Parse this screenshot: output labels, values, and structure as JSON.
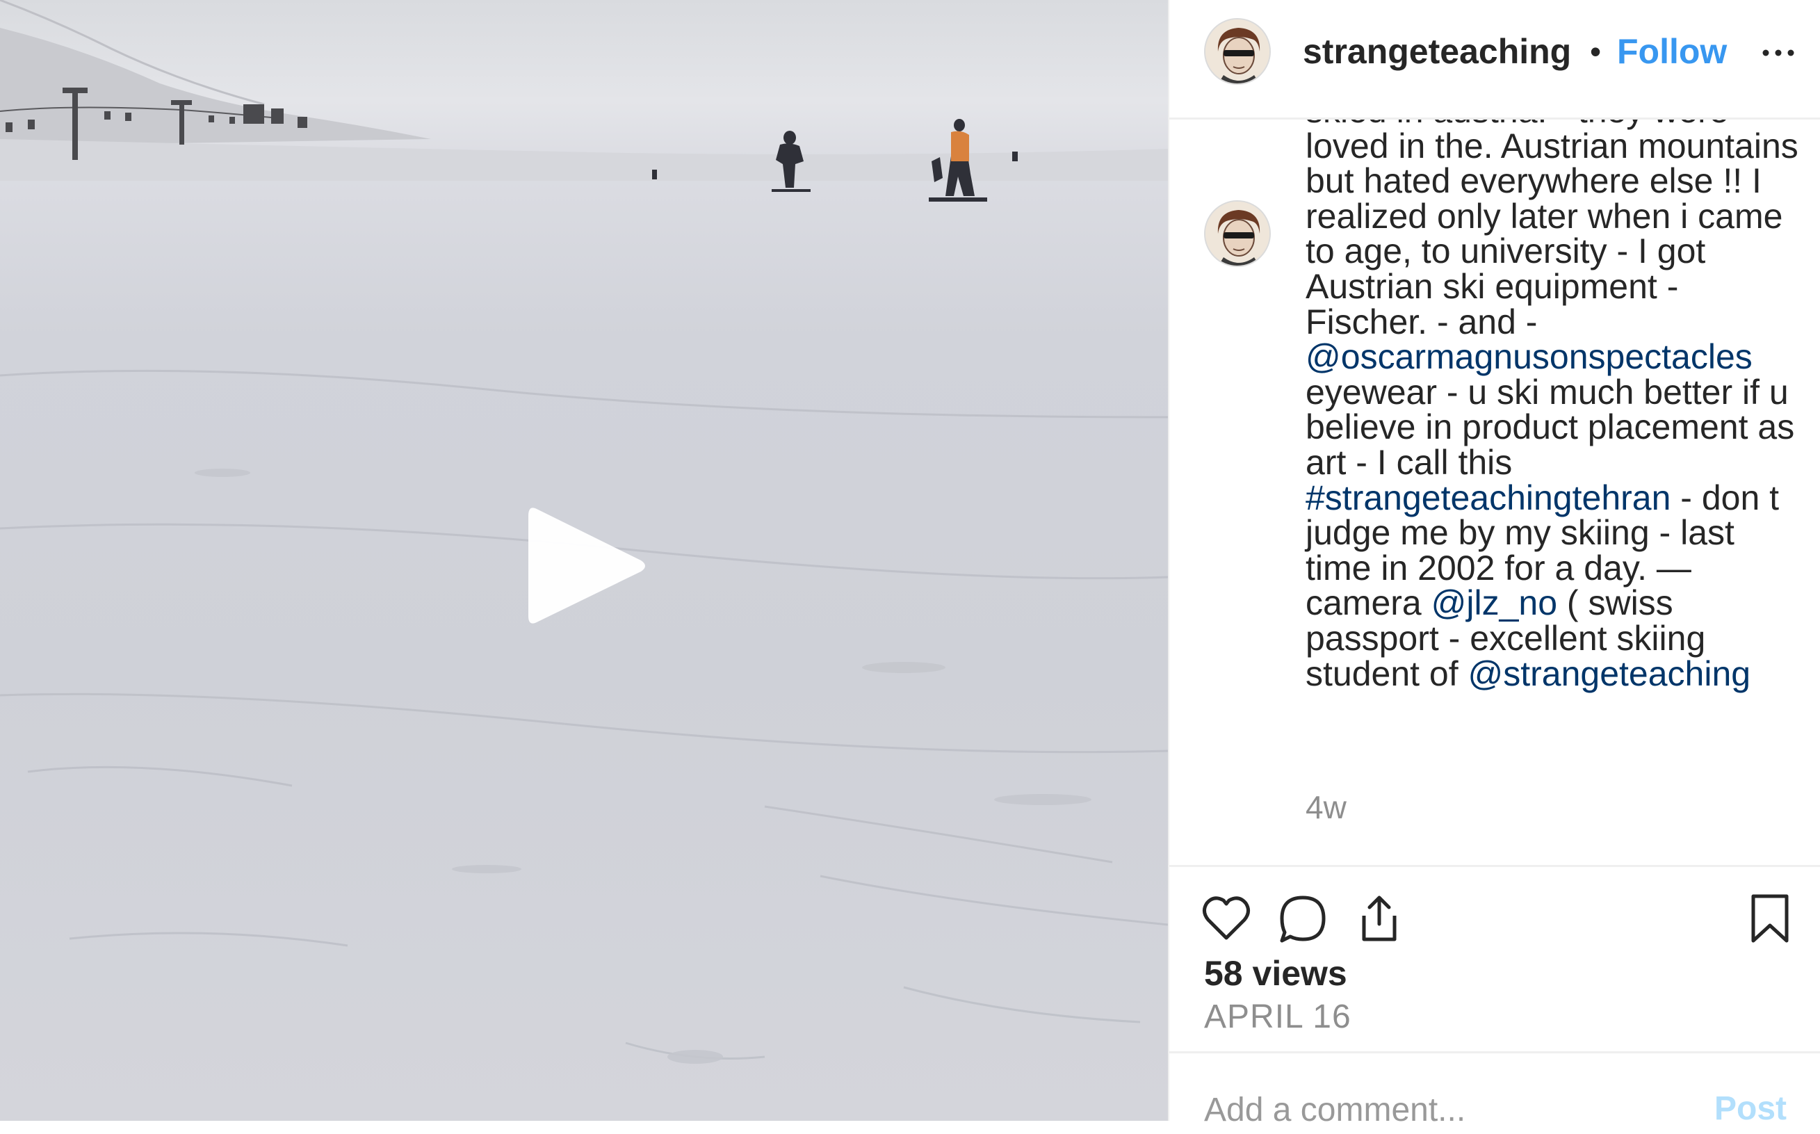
{
  "post": {
    "username": "strangeteaching",
    "separator": "•",
    "follow_label": "Follow",
    "more_icon": "more-horizontal-icon"
  },
  "caption": {
    "part1": "skied in austria. - they were loved in the. Austrian mountains but hated everywhere else !! I realized only later when i came to age, to university - I got Austrian ski equipment - Fischer. - and - ",
    "mention1": "@oscarmagnusonspectacles",
    "part2": " eyewear - u ski much better if u believe in product placement as art - I call this ",
    "hashtag1": "#strangeteachingtehran",
    "part3": " - don t judge me by my skiing - last time in 2002 for a day. — camera ",
    "mention2": "@jlz_no",
    "part4": " ( swiss passport - excellent skiing student of ",
    "mention3": "@strangeteaching",
    "timestamp": "4w"
  },
  "stats": {
    "views": "58 views",
    "date": "APRIL 16"
  },
  "comment_box": {
    "placeholder": "Add a comment...",
    "post_label": "Post"
  },
  "icons": [
    "heart-icon",
    "comment-icon",
    "share-icon",
    "bookmark-icon",
    "play-icon"
  ],
  "colors": {
    "link_blue": "#3897f0",
    "tag_navy": "#003569",
    "muted_gray": "#8e8e8e",
    "post_disabled": "#b2dffc"
  }
}
